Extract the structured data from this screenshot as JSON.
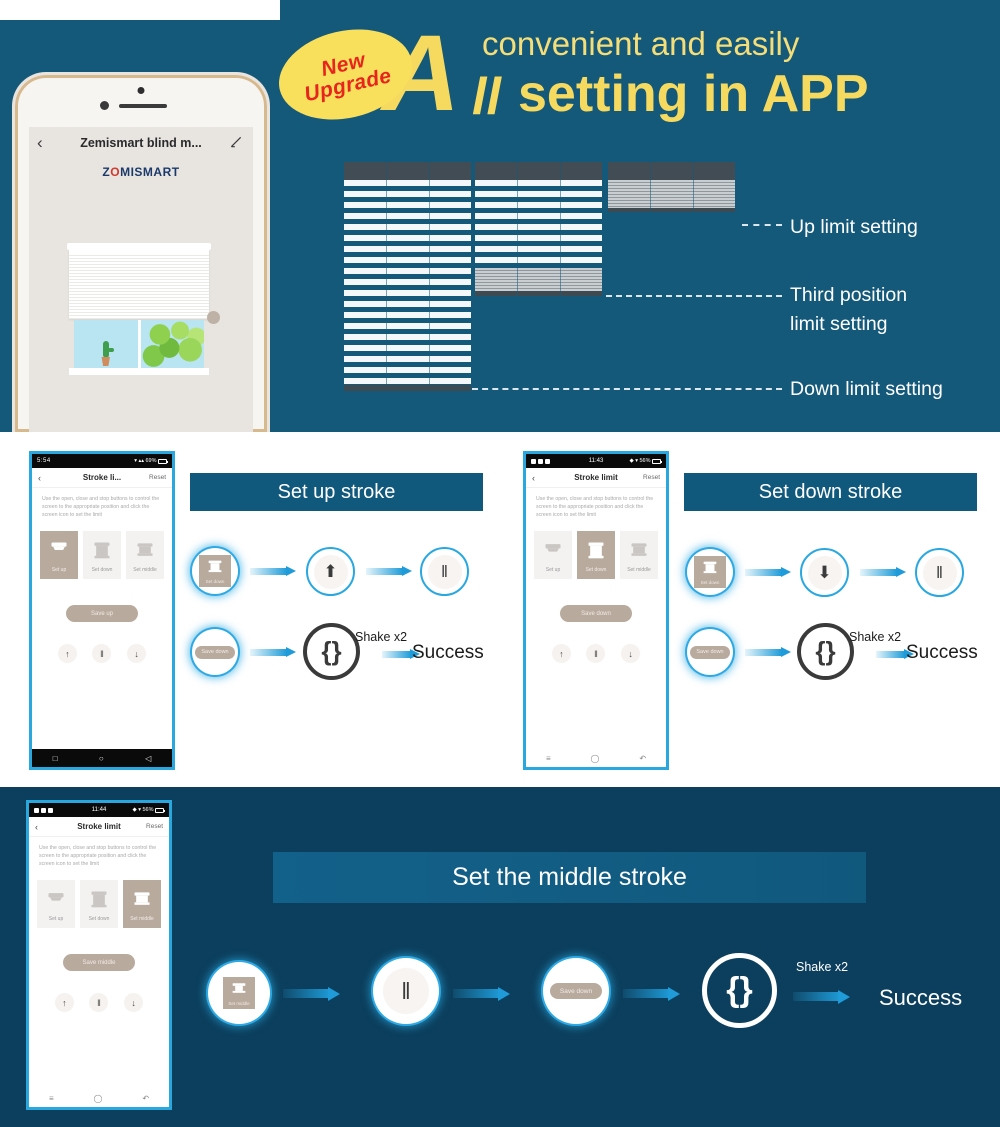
{
  "colors": {
    "hero_bg": "#15597a",
    "section3_bg": "#0c3f5d",
    "accent_blue": "#29a8e0",
    "banner_blue": "#11587d",
    "yellow": "#f6d95f",
    "badge_yellow": "#f9e05c",
    "badge_red": "#e8241f",
    "beige": "#b9aa9e"
  },
  "hero": {
    "badge": {
      "line1": "New",
      "line2": "Upgrade"
    },
    "headline": {
      "big_letter": "A",
      "italic_ll": "ll",
      "subtitle": "convenient and easily",
      "main": "setting in APP"
    },
    "phone": {
      "title": "Zemismart blind m...",
      "back_icon": "chevron-left-icon",
      "edit_icon": "pencil-icon",
      "brand_pre": "Z",
      "brand_o": "O",
      "brand_post": "MISMART"
    },
    "diagram": {
      "labels": [
        {
          "text": "Up limit setting"
        },
        {
          "text": "Third position\nlimit setting"
        },
        {
          "text": "Down limit setting"
        }
      ]
    }
  },
  "section2": {
    "left": {
      "phone": {
        "status": {
          "time": "5:54",
          "battery": "69%"
        },
        "nav": {
          "back": "‹",
          "title": "Stroke li...",
          "reset": "Reset"
        },
        "description": "Use the open, close and stop buttons to control the screen to the appropriate position and click the screen icon to set the limit",
        "cards": [
          {
            "label": "Set up",
            "active": true
          },
          {
            "label": "Set down",
            "active": false
          },
          {
            "label": "Set middle",
            "active": false
          }
        ],
        "save_label": "Save up",
        "controls": [
          "↑",
          "‖",
          "↓"
        ],
        "bottom_nav": [
          "□",
          "○",
          "◁"
        ]
      },
      "banner": "Set up stroke",
      "flow_row1": [
        {
          "type": "card",
          "label": "Set down",
          "icon": "blind-icon"
        },
        {
          "type": "button",
          "icon": "arrow-up-icon",
          "glyph": "⬆"
        },
        {
          "type": "button",
          "icon": "pause-icon",
          "glyph": "‖"
        }
      ],
      "flow_row2": [
        {
          "type": "pill",
          "label": "Save down"
        },
        {
          "type": "shake",
          "icon": "shake-icon"
        }
      ],
      "shake_label": "Shake x2",
      "success_label": "Success"
    },
    "right": {
      "phone": {
        "status": {
          "time": "11:43",
          "battery": "56%"
        },
        "nav": {
          "back": "‹",
          "title": "Stroke limit",
          "reset": "Reset"
        },
        "description": "Use the open, close and stop buttons to control the screen to the appropriate position and click the screen icon to set the limit",
        "cards": [
          {
            "label": "Set up",
            "active": false
          },
          {
            "label": "Set down",
            "active": true
          },
          {
            "label": "Set middle",
            "active": false
          }
        ],
        "save_label": "Save down",
        "controls": [
          "↑",
          "‖",
          "↓"
        ],
        "bottom_nav": [
          "≡",
          "◯",
          "↶"
        ]
      },
      "banner": "Set down stroke",
      "flow_row1": [
        {
          "type": "card",
          "label": "Set down",
          "icon": "blind-icon"
        },
        {
          "type": "button",
          "icon": "arrow-down-icon",
          "glyph": "⬇"
        },
        {
          "type": "button",
          "icon": "pause-icon",
          "glyph": "‖"
        }
      ],
      "flow_row2": [
        {
          "type": "pill",
          "label": "Save down"
        },
        {
          "type": "shake",
          "icon": "shake-icon"
        }
      ],
      "shake_label": "Shake x2",
      "success_label": "Success"
    }
  },
  "section3": {
    "phone": {
      "status": {
        "time": "11:44",
        "battery": "56%"
      },
      "nav": {
        "back": "‹",
        "title": "Stroke limit",
        "reset": "Reset"
      },
      "description": "Use the open, close and stop buttons to control the screen to the appropriate position and click the screen icon to set the limit",
      "cards": [
        {
          "label": "Set up",
          "active": false
        },
        {
          "label": "Set down",
          "active": false
        },
        {
          "label": "Set middle",
          "active": true
        }
      ],
      "save_label": "Save middle",
      "controls": [
        "↑",
        "‖",
        "↓"
      ],
      "bottom_nav": [
        "≡",
        "◯",
        "↶"
      ]
    },
    "banner": "Set the middle stroke",
    "flow": [
      {
        "type": "card",
        "label": "Set middle",
        "icon": "blind-icon"
      },
      {
        "type": "button",
        "icon": "pause-icon",
        "glyph": "‖"
      },
      {
        "type": "pill",
        "label": "Save down"
      },
      {
        "type": "shake",
        "icon": "shake-icon"
      }
    ],
    "shake_label": "Shake x2",
    "success_label": "Success"
  }
}
